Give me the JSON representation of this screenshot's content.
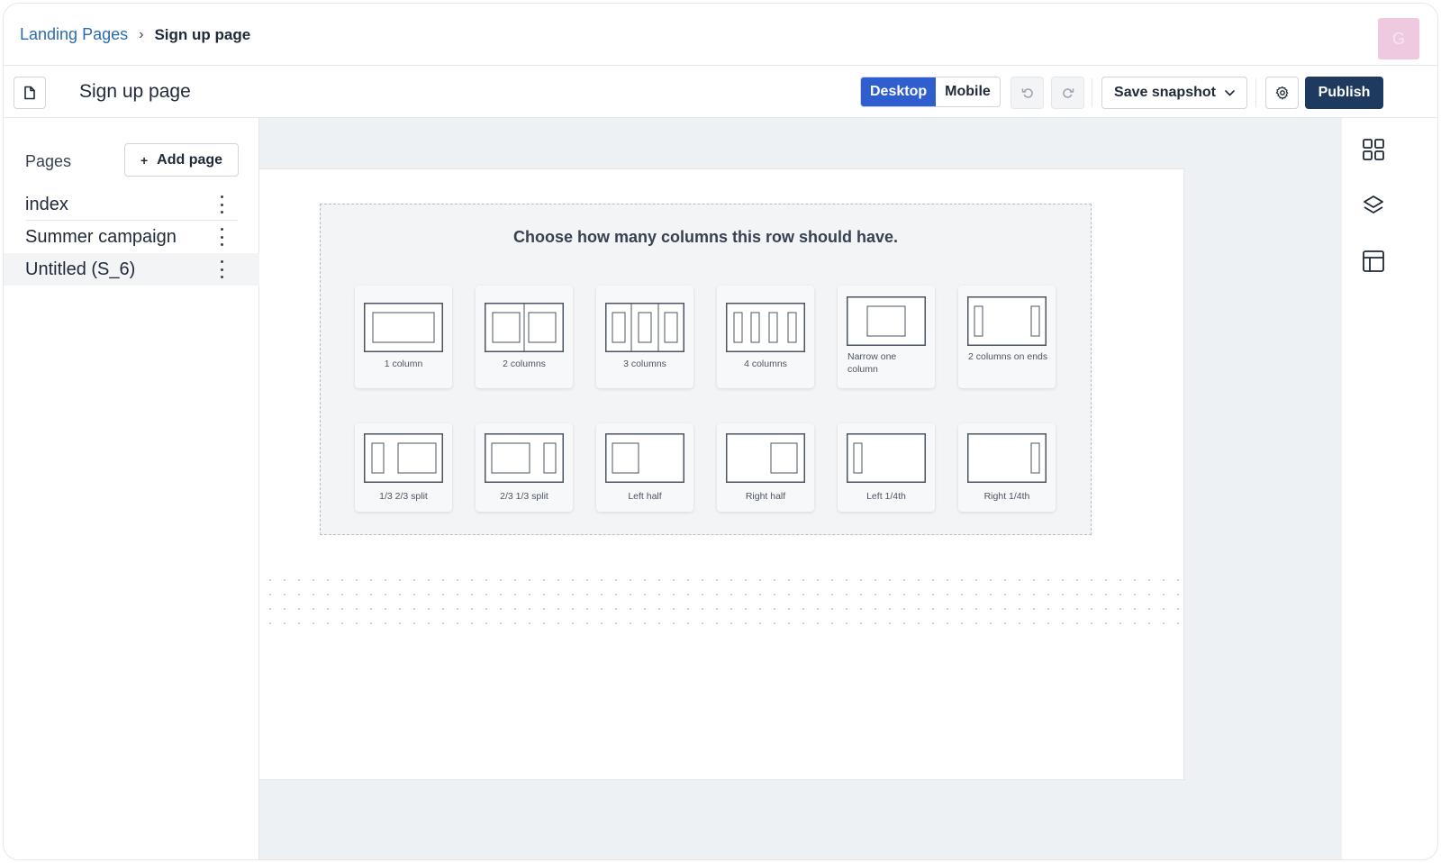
{
  "breadcrumb": {
    "parent": "Landing Pages",
    "separator": "›",
    "current": "Sign up page"
  },
  "user": {
    "avatar_initial": "G",
    "avatar_color": "#eec9e0"
  },
  "toolbar": {
    "page_title": "Sign up page",
    "device_options": [
      "Desktop",
      "Mobile"
    ],
    "device_selected": "Desktop",
    "save_snapshot_label": "Save snapshot",
    "publish_label": "Publish",
    "icons": {
      "page": "file-icon",
      "undo": "undo-icon",
      "redo": "redo-icon",
      "settings": "gear-icon",
      "dropdown": "chevron-down-icon"
    }
  },
  "sidebar": {
    "header": "Pages",
    "add_page_label": "Add page",
    "add_page_icon": "+",
    "pages": [
      {
        "name": "index",
        "selected": false
      },
      {
        "name": "Summer campaign",
        "selected": false
      },
      {
        "name": "Untitled (S_6)",
        "selected": true
      }
    ]
  },
  "canvas": {
    "picker_title": "Choose how many columns this row should have.",
    "layouts": [
      {
        "id": "one-column",
        "label": "1 column"
      },
      {
        "id": "two-columns",
        "label": "2 columns"
      },
      {
        "id": "three-columns",
        "label": "3 columns"
      },
      {
        "id": "four-columns",
        "label": "4 columns"
      },
      {
        "id": "narrow-one-column",
        "label": "Narrow one column"
      },
      {
        "id": "two-columns-on-ends",
        "label": "2 columns on ends"
      },
      {
        "id": "one-third-two-thirds",
        "label": "1/3 2/3 split"
      },
      {
        "id": "two-thirds-one-third",
        "label": "2/3 1/3 split"
      },
      {
        "id": "left-half",
        "label": "Left half"
      },
      {
        "id": "right-half",
        "label": "Right half"
      },
      {
        "id": "left-quarter",
        "label": "Left 1/4th"
      },
      {
        "id": "right-quarter",
        "label": "Right 1/4th"
      }
    ]
  },
  "right_rail": {
    "icons": [
      "grid-icon",
      "layers-icon",
      "layout-icon"
    ]
  },
  "colors": {
    "accent": "#2f5fcf",
    "link": "#2b6cb0",
    "publish": "#1e3a5f",
    "canvas_bg": "#eef1f4"
  }
}
